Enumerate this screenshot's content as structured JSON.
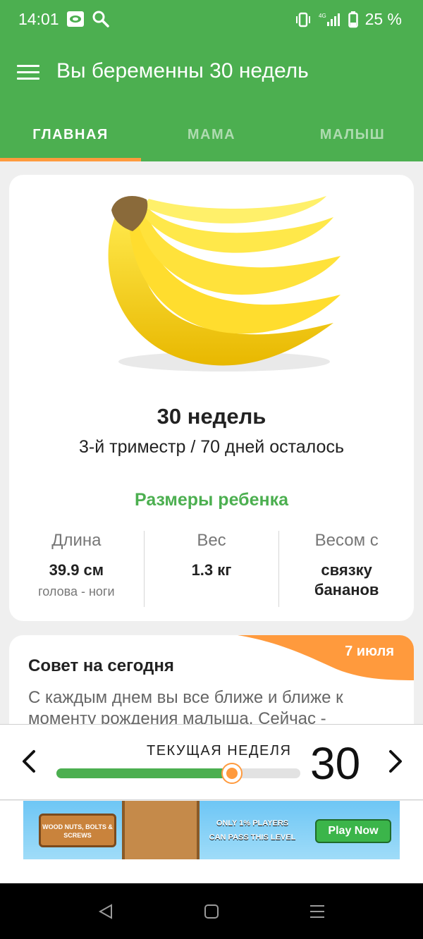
{
  "status_bar": {
    "time": "14:01",
    "network": "4G",
    "battery": "25 %"
  },
  "app_bar": {
    "title": "Вы беременны 30 недель"
  },
  "tabs": [
    {
      "label": "ГЛАВНАЯ",
      "active": true
    },
    {
      "label": "МАМА",
      "active": false
    },
    {
      "label": "МАЛЫШ",
      "active": false
    }
  ],
  "main_card": {
    "week_title": "30 недель",
    "trimester_text": "3-й триместр / 70 дней осталось",
    "sizes_title": "Размеры ребенка",
    "metrics": [
      {
        "label": "Длина",
        "value": "39.9 см",
        "sub": "голова - ноги"
      },
      {
        "label": "Вес",
        "value": "1.3 кг",
        "sub": ""
      },
      {
        "label": "Весом с",
        "value": "связку бананов",
        "sub": ""
      }
    ]
  },
  "tip_card": {
    "date": "7 июля",
    "title": "Совет на сегодня",
    "text": "С каждым днем вы все ближе и ближе к моменту рождения малыша. Сейчас -"
  },
  "week_selector": {
    "label": "ТЕКУЩАЯ НЕДЕЛЯ",
    "current_week": "30",
    "progress": 0.72
  },
  "ad": {
    "logo_text": "WOOD NUTS, BOLTS & SCREWS",
    "text_line1": "ONLY 1% PLAYERS",
    "text_line2": "CAN PASS THIS LEVEL",
    "cta": "Play Now"
  },
  "colors": {
    "primary": "#4caf50",
    "accent": "#ff9a3d"
  }
}
